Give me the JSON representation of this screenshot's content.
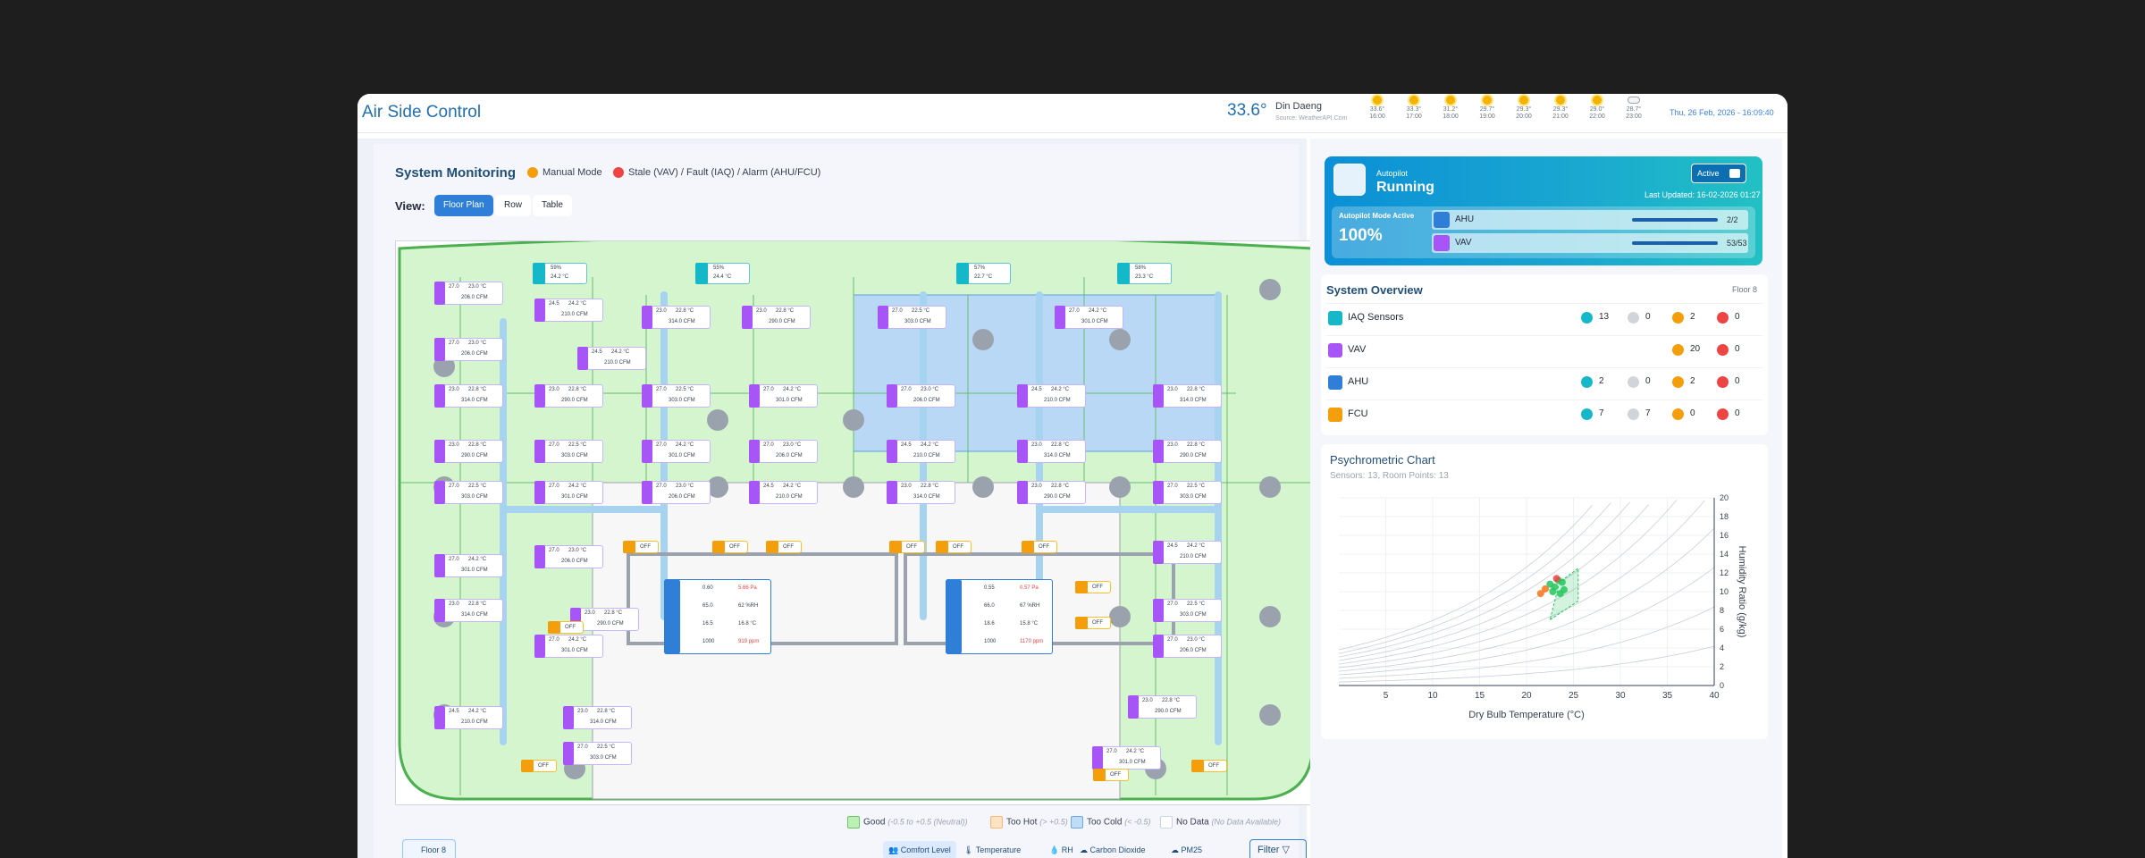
{
  "app": {
    "title": "Air Side Control"
  },
  "weather": {
    "current_temp": "33.6°",
    "city": "Din Daeng",
    "source": "Source: WeatherAPI.Com",
    "forecast": [
      {
        "temp": "33.6°",
        "time": "16:00",
        "icon": "sun-icon"
      },
      {
        "temp": "33.3°",
        "time": "17:00",
        "icon": "sun-icon"
      },
      {
        "temp": "31.2°",
        "time": "18:00",
        "icon": "sun-icon"
      },
      {
        "temp": "29.7°",
        "time": "19:00",
        "icon": "sun-icon"
      },
      {
        "temp": "29.3°",
        "time": "20:00",
        "icon": "sun-icon"
      },
      {
        "temp": "29.3°",
        "time": "21:00",
        "icon": "sun-icon"
      },
      {
        "temp": "29.0°",
        "time": "22:00",
        "icon": "sun-icon"
      },
      {
        "temp": "28.7°",
        "time": "23:00",
        "icon": "cloud-icon"
      }
    ],
    "datetime": "Thu, 26 Feb, 2026 - 16:09:40"
  },
  "monitoring": {
    "title": "System Monitoring",
    "mode": "Manual Mode",
    "status_legend": "Stale (VAV) / Fault (IAQ) / Alarm (AHU/FCU)",
    "view_label": "View:",
    "views": [
      "Floor Plan",
      "Row",
      "Table"
    ],
    "active_view": "Floor Plan"
  },
  "floorplan": {
    "ahu_left": {
      "rows": [
        [
          "0.60",
          "5.66 Pa"
        ],
        [
          "65.0",
          "62 %RH"
        ],
        [
          "16.5",
          "16.8 °C"
        ],
        [
          "1000",
          "919 ppm"
        ]
      ]
    },
    "ahu_right": {
      "rows": [
        [
          "0.55",
          "0.57 Pa"
        ],
        [
          "66.0",
          "67 %RH"
        ],
        [
          "18.6",
          "15.8 °C"
        ],
        [
          "1000",
          "1170 ppm"
        ]
      ]
    },
    "fcu_off": "OFF",
    "iaq": [
      {
        "rh": "59%",
        "temp": "24.2 °C"
      },
      {
        "rh": "55%",
        "temp": "24.4 °C"
      },
      {
        "rh": "57%",
        "temp": "22.7 °C"
      },
      {
        "rh": "58%",
        "temp": "23.3 °C"
      }
    ],
    "vav_samples": [
      {
        "sp": "27.0",
        "temp": "23.0 °C",
        "flow": "206.0 CFM"
      },
      {
        "sp": "24.5",
        "temp": "24.2 °C",
        "flow": "210.0 CFM"
      },
      {
        "sp": "23.0",
        "temp": "22.8 °C",
        "flow": "314.0 CFM"
      },
      {
        "sp": "23.0",
        "temp": "22.8 °C",
        "flow": "290.0 CFM"
      },
      {
        "sp": "27.0",
        "temp": "22.5 °C",
        "flow": "303.0 CFM"
      },
      {
        "sp": "27.0",
        "temp": "24.2 °C",
        "flow": "301.0 CFM"
      }
    ]
  },
  "legend": {
    "good": "Good",
    "good_note": "(-0.5 to +0.5 (Neutral))",
    "hot": "Too Hot",
    "hot_note": "(> +0.5)",
    "cold": "Too Cold",
    "cold_note": "(< -0.5)",
    "nodata": "No Data",
    "nodata_note": "(No Data Available)"
  },
  "toolbar": {
    "floor": "Floor 8",
    "comfort": "Comfort Level",
    "temperature": "Temperature",
    "rh": "RH",
    "co2": "Carbon Dioxide",
    "pm25": "PM25",
    "filter": "Filter"
  },
  "autopilot": {
    "label": "Autopilot",
    "status": "Running",
    "active_label": "Active",
    "updated": "Last Updated: 16-02-2026 01:27",
    "mode_label": "Autopilot Mode Active",
    "percent": "100%",
    "rows": [
      {
        "name": "AHU",
        "count": "2/2",
        "fraction": 1.0
      },
      {
        "name": "VAV",
        "count": "53/53",
        "fraction": 1.0
      }
    ]
  },
  "overview": {
    "title": "System Overview",
    "floor": "Floor 8",
    "rows": [
      {
        "name": "IAQ Sensors",
        "c1": "13",
        "c2": "0",
        "c3": "2",
        "c4": "0",
        "color": "#14b8c9"
      },
      {
        "name": "VAV",
        "c3": "20",
        "c4": "0",
        "color": "#a855f7"
      },
      {
        "name": "AHU",
        "c1": "2",
        "c2": "0",
        "c3": "2",
        "c4": "0",
        "color": "#2f7ed8"
      },
      {
        "name": "FCU",
        "c1": "7",
        "c2": "7",
        "c3": "0",
        "c4": "0",
        "color": "#f59e0b"
      }
    ]
  },
  "psychrometric": {
    "title": "Psychrometric Chart",
    "subtitle": "Sensors: 13, Room Points: 13"
  },
  "chart_data": {
    "type": "scatter",
    "title": "",
    "xlabel": "Dry Bulb Temperature (°C)",
    "ylabel": "Humidity Ratio (g/kg)",
    "xlim": [
      0,
      40
    ],
    "ylim": [
      0,
      20
    ],
    "xticks": [
      5,
      10,
      15,
      20,
      25,
      30,
      35,
      40
    ],
    "yticks": [
      0,
      2,
      4,
      6,
      8,
      10,
      12,
      14,
      16,
      18,
      20
    ],
    "comfort_zone": [
      [
        22.5,
        7.0
      ],
      [
        25.5,
        9.0
      ],
      [
        25.5,
        12.5
      ],
      [
        23.5,
        11.0
      ],
      [
        22.5,
        7.0
      ]
    ],
    "series": [
      {
        "color": "#22c55e",
        "x": [
          23.0,
          23.4,
          23.8,
          24.0,
          23.6,
          22.8,
          22.5
        ],
        "y": [
          10.5,
          11.2,
          11.0,
          10.2,
          9.8,
          10.0,
          10.8
        ]
      },
      {
        "color": "#f97316",
        "x": [
          21.5,
          22.0
        ],
        "y": [
          9.8,
          10.3
        ]
      },
      {
        "color": "#ef4444",
        "x": [
          23.2
        ],
        "y": [
          11.4
        ]
      }
    ]
  }
}
